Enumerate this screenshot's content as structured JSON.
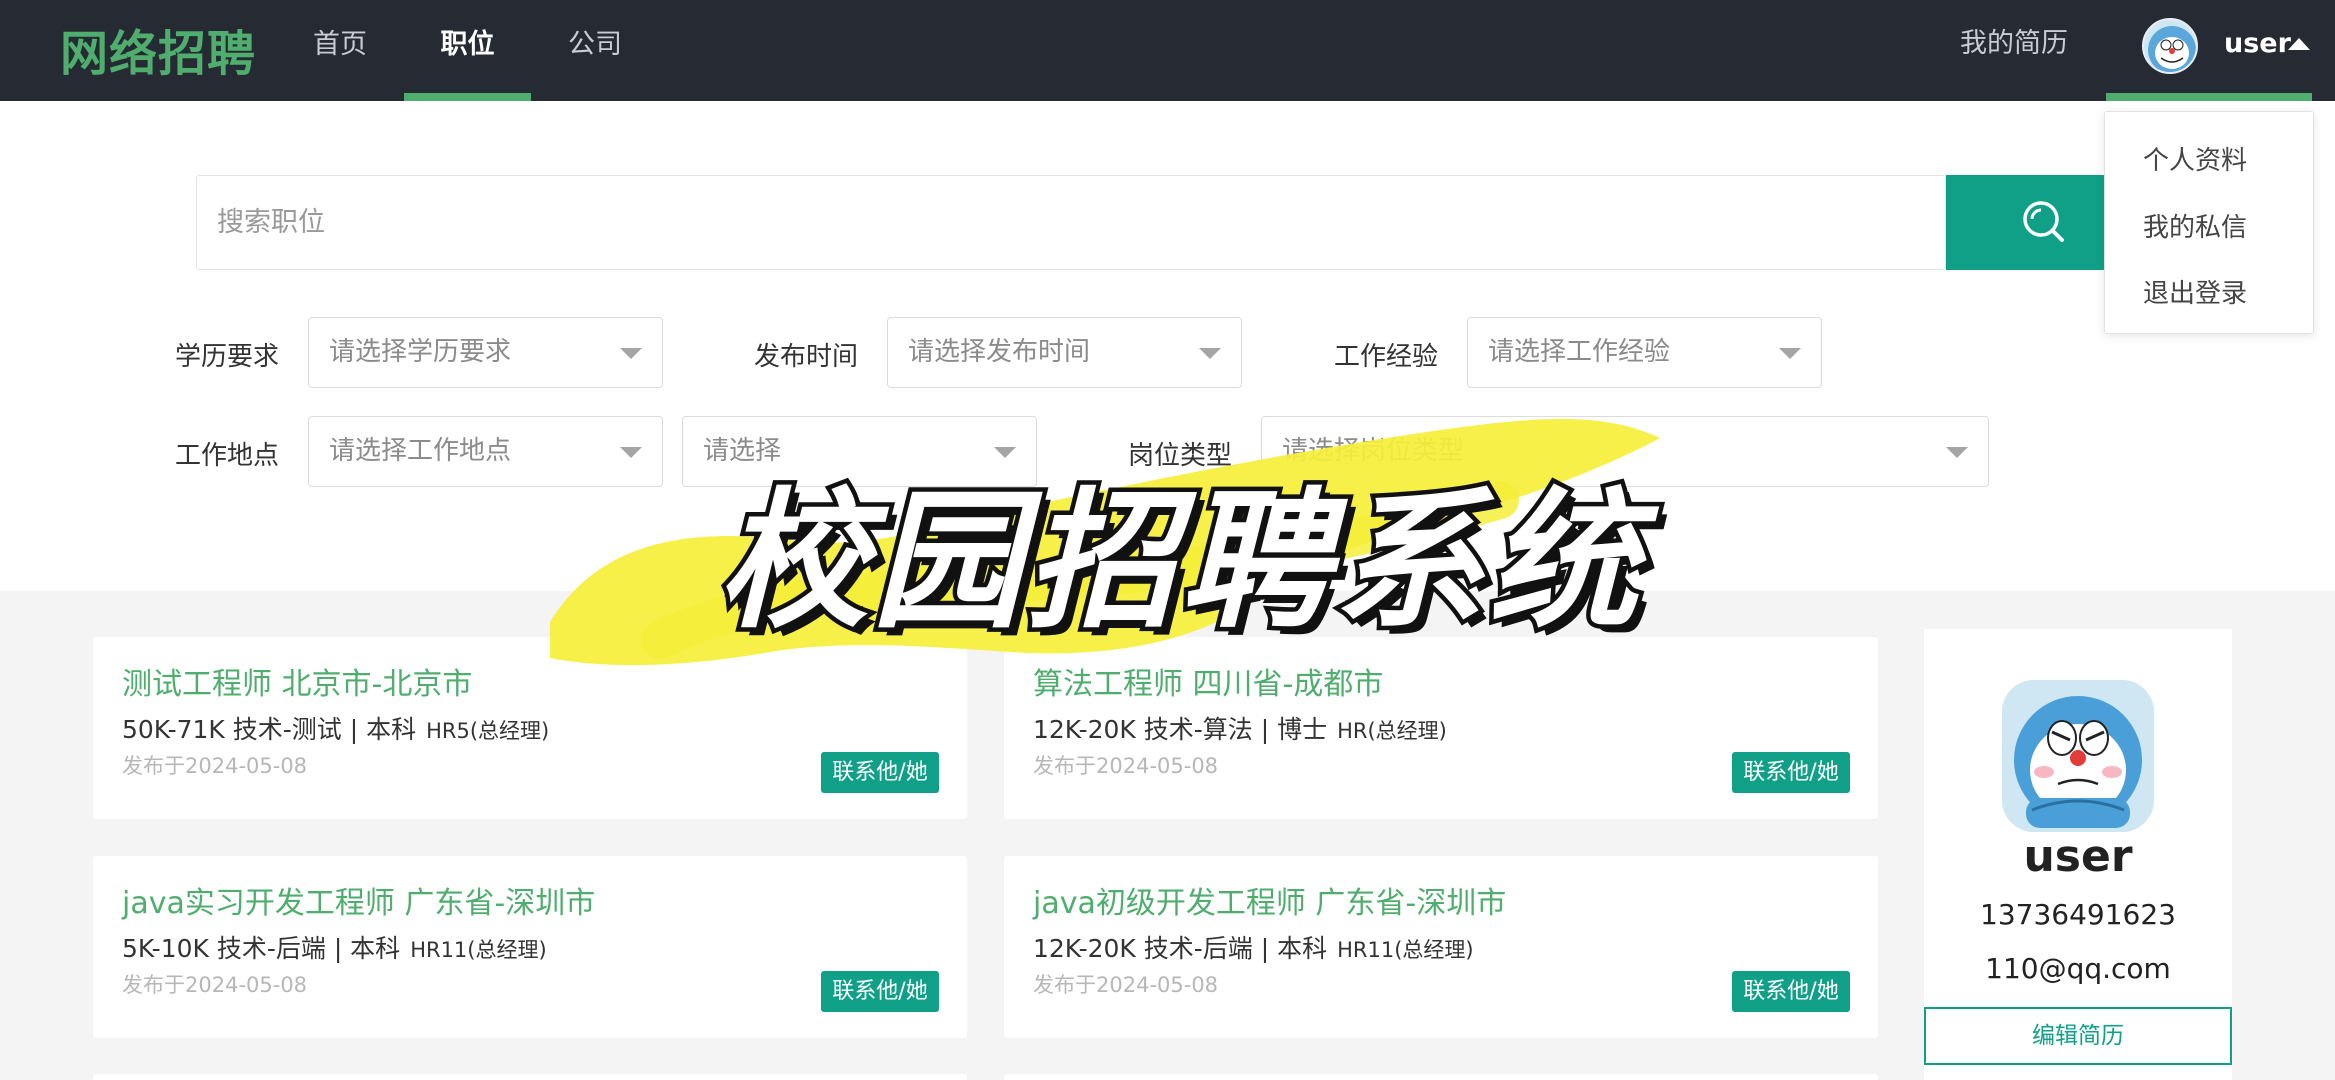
{
  "app": {
    "logo": "网络招聘"
  },
  "nav": {
    "items": [
      {
        "label": "首页"
      },
      {
        "label": "职位"
      },
      {
        "label": "公司"
      }
    ],
    "active_index": 1,
    "resume_link": "我的简历",
    "user_name": "user"
  },
  "user_menu": {
    "items": [
      "个人资料",
      "我的私信",
      "退出登录"
    ]
  },
  "search": {
    "placeholder": "搜索职位",
    "button_icon": "search-icon"
  },
  "filters": {
    "education": {
      "label": "学历要求",
      "placeholder": "请选择学历要求"
    },
    "publish_time": {
      "label": "发布时间",
      "placeholder": "请选择发布时间"
    },
    "experience": {
      "label": "工作经验",
      "placeholder": "请选择工作经验"
    },
    "location": {
      "label": "工作地点",
      "placeholder": "请选择工作地点",
      "sub_placeholder": "请选择"
    },
    "job_type": {
      "label": "岗位类型",
      "placeholder": "请选择岗位类型"
    }
  },
  "jobs": [
    {
      "title": "测试工程师  北京市-北京市",
      "meta": "50K-71K  技术-测试 | 本科",
      "hr": "HR5(总经理)",
      "date": "发布于2024-05-08",
      "action": "联系他/她"
    },
    {
      "title": "算法工程师  四川省-成都市",
      "meta": "12K-20K  技术-算法 | 博士",
      "hr": "HR(总经理)",
      "date": "发布于2024-05-08",
      "action": "联系他/她"
    },
    {
      "title": "java实习开发工程师  广东省-深圳市",
      "meta": "5K-10K  技术-后端 | 本科",
      "hr": "HR11(总经理)",
      "date": "发布于2024-05-08",
      "action": "联系他/她"
    },
    {
      "title": "java初级开发工程师  广东省-深圳市",
      "meta": "12K-20K  技术-后端 | 本科",
      "hr": "HR11(总经理)",
      "date": "发布于2024-05-08",
      "action": "联系他/她"
    }
  ],
  "profile": {
    "name": "user",
    "phone": "13736491623",
    "email": "110@qq.com",
    "edit_label": "编辑简历"
  },
  "overlay": {
    "title": "校园招聘系统"
  },
  "colors": {
    "header_bg": "#262a33",
    "accent_green": "#4fae6e",
    "button_teal": "#10a088",
    "banner_yellow": "#f5ef3a"
  }
}
